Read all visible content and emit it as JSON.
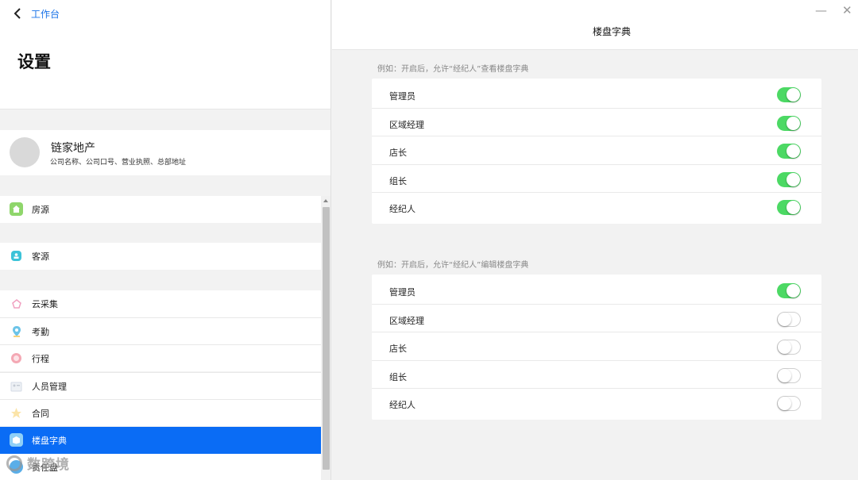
{
  "header": {
    "back_label": "工作台",
    "title": "设置"
  },
  "company": {
    "name": "链家地产",
    "description": "公司名称、公司口号、营业执照、总部地址"
  },
  "menu": {
    "items": [
      {
        "label": "房源",
        "icon": "house-icon",
        "color": "#8fd66b"
      },
      {
        "label": "客源",
        "icon": "customer-icon",
        "color": "#3cc3d8"
      },
      {
        "label": "云采集",
        "icon": "cloud-collect-icon",
        "color": "#f3c6d6"
      },
      {
        "label": "考勤",
        "icon": "location-pin-icon",
        "color": "#6cc4e8"
      },
      {
        "label": "行程",
        "icon": "schedule-icon",
        "color": "#f4a8b4"
      },
      {
        "label": "人员管理",
        "icon": "people-icon",
        "color": "#d4dbe6"
      },
      {
        "label": "合同",
        "icon": "contract-icon",
        "color": "#f6d27c"
      },
      {
        "label": "楼盘字典",
        "icon": "building-dict-icon",
        "color": "#8fd0f7",
        "active": true
      },
      {
        "label": "责任盘",
        "icon": "responsibility-icon",
        "color": "#5aaee8"
      }
    ]
  },
  "watermark": "数跨境",
  "detail": {
    "title": "楼盘字典",
    "view_section": {
      "label": "例如：开启后，允许“经纪人”查看楼盘字典",
      "rows": [
        {
          "label": "管理员",
          "enabled": true
        },
        {
          "label": "区域经理",
          "enabled": true
        },
        {
          "label": "店长",
          "enabled": true
        },
        {
          "label": "组长",
          "enabled": true
        },
        {
          "label": "经纪人",
          "enabled": true
        }
      ]
    },
    "edit_section": {
      "label": "例如：开启后，允许“经纪人”编辑楼盘字典",
      "rows": [
        {
          "label": "管理员",
          "enabled": true
        },
        {
          "label": "区域经理",
          "enabled": false
        },
        {
          "label": "店长",
          "enabled": false
        },
        {
          "label": "组长",
          "enabled": false
        },
        {
          "label": "经纪人",
          "enabled": false
        }
      ]
    }
  },
  "window": {
    "minimize_glyph": "—",
    "close_glyph": "✕"
  },
  "colors": {
    "accent": "#0a6cf5",
    "toggle_on": "#4cd964",
    "link": "#1a73e8"
  }
}
